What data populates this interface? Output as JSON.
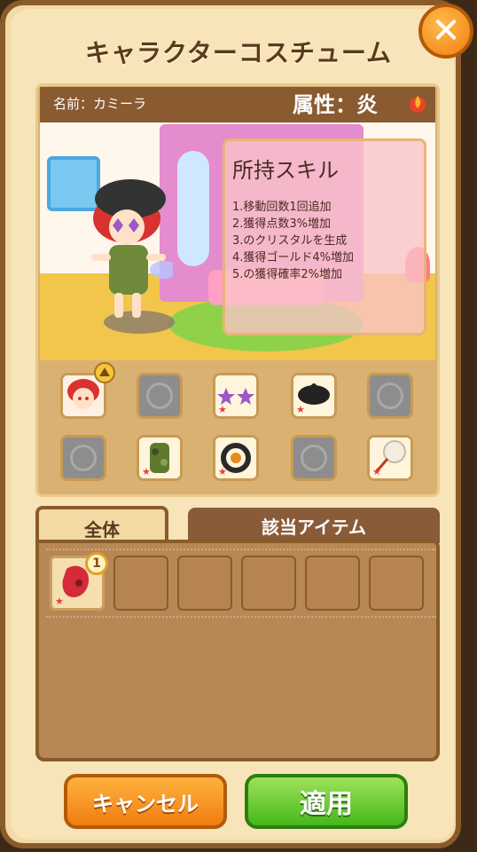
{
  "window": {
    "title": "キャラクターコスチューム",
    "close_icon": "close-icon"
  },
  "character": {
    "name_label": "名前：カミーラ",
    "attribute_label": "属性：炎",
    "attribute_icon": "fire-icon"
  },
  "skills": {
    "title": "所持スキル",
    "items": [
      "1.移動回数1回追加",
      "2.獲得点数3%増加",
      "3.のクリスタルを生成",
      "4.獲得ゴールド4%増加",
      "5.の獲得確率2%増加"
    ]
  },
  "equipment_slots": [
    {
      "icon": "character-portrait-icon",
      "filled": true,
      "upgrade_badge": true
    },
    {
      "icon": "hair-icon",
      "filled": false
    },
    {
      "icon": "star-sunglasses-icon",
      "filled": true
    },
    {
      "icon": "beret-hat-icon",
      "filled": true
    },
    {
      "icon": "pendant-icon",
      "filled": false
    },
    {
      "icon": "face-accessory-icon",
      "filled": false
    },
    {
      "icon": "camo-outfit-icon",
      "filled": true
    },
    {
      "icon": "bracelet-icon",
      "filled": true
    },
    {
      "icon": "wings-icon",
      "filled": false
    },
    {
      "icon": "fan-icon",
      "filled": true
    }
  ],
  "tabs": [
    {
      "label": "全体",
      "active": true
    },
    {
      "label": "該当アイテム",
      "active": false
    }
  ],
  "inventory": {
    "items": [
      {
        "icon": "red-outfit-icon",
        "count": "1"
      },
      {
        "icon": "",
        "count": ""
      },
      {
        "icon": "",
        "count": ""
      },
      {
        "icon": "",
        "count": ""
      },
      {
        "icon": "",
        "count": ""
      },
      {
        "icon": "",
        "count": ""
      }
    ]
  },
  "buttons": {
    "cancel_label": "キャンセル",
    "apply_label": "適用"
  },
  "colors": {
    "frame": "#8a5b2a",
    "panel": "#f3d9a4",
    "cancel": "#f07d10",
    "apply": "#45b81a"
  }
}
